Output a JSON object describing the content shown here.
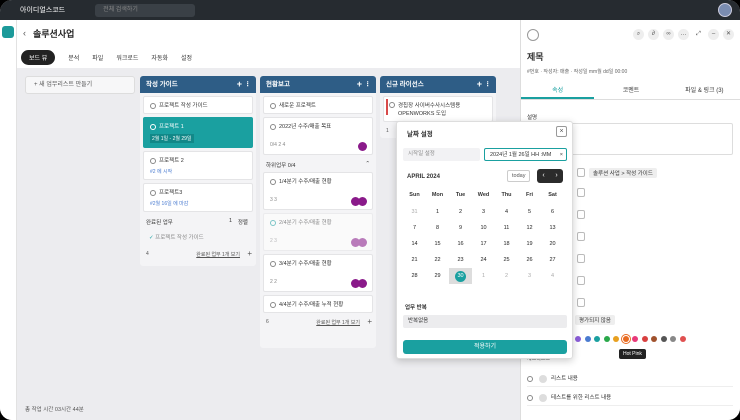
{
  "app": {
    "name": "아이디얼스코드",
    "search_placeholder": "전체 검색하기"
  },
  "header": {
    "title": "솔루션사업",
    "tabs": [
      "보드 뷰",
      "분석",
      "파일",
      "워크로드",
      "자동화",
      "설정"
    ]
  },
  "board": {
    "new_list": "+ 새 업무리스트 만들기",
    "work_time": "총 작업 시간 03시간 44분"
  },
  "columns": [
    {
      "title": "작성 가이드",
      "cards": [
        {
          "title": "프로젝트 작성 가이드"
        },
        {
          "title": "프로젝트 1",
          "sub": "2월 1일 - 2월 29일"
        },
        {
          "title": "프로젝트 2",
          "sub": "#2 에 시작"
        },
        {
          "title": "프로젝트3",
          "sub": "#2월 16일 에 마감"
        }
      ],
      "done": "완료된 업무",
      "done_count": "1",
      "sort": "정렬",
      "done_card": "프로젝트 작성 가이드",
      "footer_count": "4",
      "footer_link": "완료된 업무 1개 보기"
    },
    {
      "title": "현황보고",
      "cards": [
        {
          "title": "새로운 프로젝트"
        },
        {
          "title": "2022년 수주/매출 목표",
          "sub": "0/4  2  4"
        }
      ],
      "subtask": "하위업무 0/4",
      "subcards": [
        {
          "title": "1/4분기 수주/매출 현황",
          "sub": "3  3"
        },
        {
          "title": "2/4분기 수주/매출 현황",
          "sub": "2  3"
        },
        {
          "title": "3/4분기 수주/매출 현황",
          "sub": "2  2"
        },
        {
          "title": "4/4분기 수주/매출 누적 현황"
        }
      ],
      "footer_count": "6",
      "footer_link": "완료된 업무 1개 보기"
    },
    {
      "title": "신규 라이선스",
      "cards": [
        {
          "title": "경칩장 사이버수사시스템용 OPENWORKS 도입"
        }
      ],
      "footer_count": "1"
    }
  ],
  "datepicker": {
    "title": "날짜 설정",
    "start_placeholder": "시작일 설정",
    "end_value": "2024년 1월 26일 HH :MM",
    "month": "APRIL 2024",
    "today": "today",
    "weekdays": [
      "Sun",
      "Mon",
      "Tue",
      "Wed",
      "Thu",
      "Fri",
      "Sat"
    ],
    "days": [
      "31",
      "1",
      "2",
      "3",
      "4",
      "5",
      "6",
      "7",
      "8",
      "9",
      "10",
      "11",
      "12",
      "13",
      "14",
      "15",
      "16",
      "17",
      "18",
      "19",
      "20",
      "21",
      "22",
      "23",
      "24",
      "25",
      "26",
      "27",
      "28",
      "29",
      "30",
      "1",
      "2",
      "3",
      "4"
    ],
    "repeat_label": "업무 반복",
    "repeat_value": "반복없음",
    "apply": "적용하기"
  },
  "panel": {
    "title": "제목",
    "meta": "#번호 · 작성자: 매출 · 작성일 mm월 dd일 00:00",
    "tabs": [
      "속성",
      "코멘트",
      "파일 & 링크 (3)"
    ],
    "desc": "설명",
    "breadcrumb": "솔루션 사업 > 작성 가이드",
    "rating": "평가되지 않음",
    "tooltip": "Hot Pink",
    "checklist": "체크리스트",
    "items": [
      "리스트 내용",
      "테스트를 위한 리스트 내용"
    ],
    "swatches": [
      "#8a5cd8",
      "#4a7bd0",
      "#1aa0a0",
      "#2aa84a",
      "#e8a020",
      "#e86a20",
      "#e83a7a",
      "#d84040",
      "#a0522d",
      "#555555",
      "#888888",
      "#e05050"
    ]
  }
}
